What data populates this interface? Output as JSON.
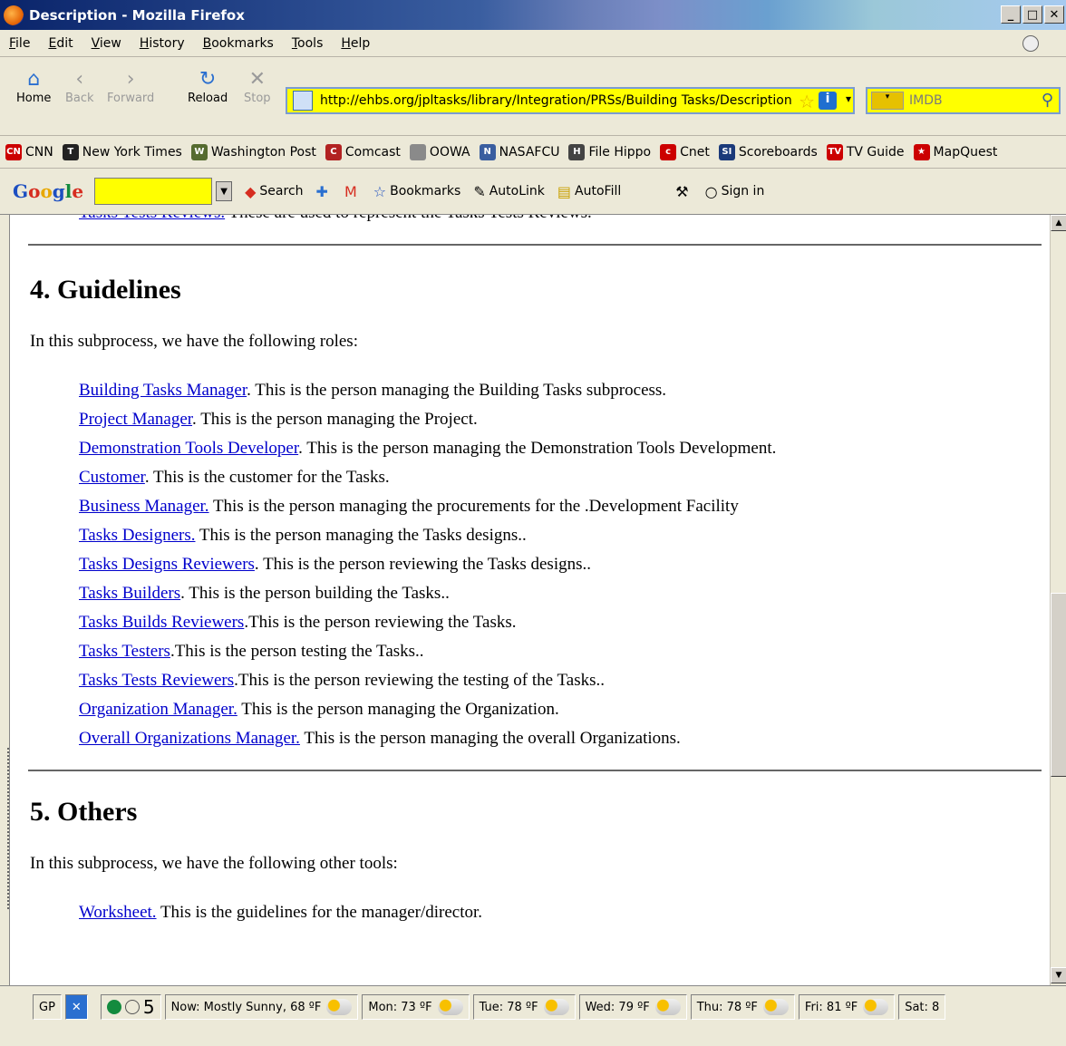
{
  "window": {
    "title": "Description - Mozilla Firefox"
  },
  "menu": [
    "File",
    "Edit",
    "View",
    "History",
    "Bookmarks",
    "Tools",
    "Help"
  ],
  "nav": {
    "home": "Home",
    "back": "Back",
    "forward": "Forward",
    "reload": "Reload",
    "stop": "Stop",
    "url": "http://ehbs.org/jpltasks/library/Integration/PRSs/Building Tasks/Description.h",
    "search_placeholder": "IMDB"
  },
  "bookmarks": [
    {
      "label": "CNN",
      "icon": "cnn-icon",
      "color": "#cc0000",
      "glyph": "CN"
    },
    {
      "label": "New York Times",
      "icon": "nyt-icon",
      "color": "#222222",
      "glyph": "T"
    },
    {
      "label": "Washington Post",
      "icon": "wapo-icon",
      "color": "#556b2f",
      "glyph": "W"
    },
    {
      "label": "Comcast",
      "icon": "comcast-icon",
      "color": "#b22222",
      "glyph": "C"
    },
    {
      "label": "OOWA",
      "icon": "page-icon",
      "color": "#8a8a8a",
      "glyph": ""
    },
    {
      "label": "NASAFCU",
      "icon": "nasafcu-icon",
      "color": "#3a5ea0",
      "glyph": "N"
    },
    {
      "label": "File Hippo",
      "icon": "filehippo-icon",
      "color": "#444444",
      "glyph": "H"
    },
    {
      "label": "Cnet",
      "icon": "cnet-icon",
      "color": "#cc0000",
      "glyph": "c"
    },
    {
      "label": "Scoreboards",
      "icon": "si-icon",
      "color": "#1b3a7a",
      "glyph": "SI"
    },
    {
      "label": "TV Guide",
      "icon": "tvguide-icon",
      "color": "#cc0000",
      "glyph": "TV"
    },
    {
      "label": "MapQuest",
      "icon": "mapquest-icon",
      "color": "#cc0000",
      "glyph": "★"
    }
  ],
  "google_toolbar": {
    "search": "Search",
    "bookmarks": "Bookmarks",
    "autolink": "AutoLink",
    "autofill": "AutoFill",
    "signin": "Sign in"
  },
  "content": {
    "top_link": "Tasks Tests Reviews.",
    "top_text": " These are used to represent the Tasks Tests Reviews.",
    "section4": {
      "heading": "4. Guidelines",
      "intro": "In this subprocess, we have the following roles:",
      "roles": [
        {
          "link": "Building Tasks Manager",
          "text": ". This is the person managing the Building Tasks subprocess."
        },
        {
          "link": "Project Manager",
          "text": ". This is the person managing the Project."
        },
        {
          "link": "Demonstration Tools Developer",
          "text": ". This is the person managing the Demonstration Tools Development."
        },
        {
          "link": "Customer",
          "text": ". This is the customer for the Tasks."
        },
        {
          "link": "Business Manager.",
          "text": " This is the person managing the procurements for the .Development Facility"
        },
        {
          "link": "Tasks Designers.",
          "text": " This is the person managing the Tasks designs.."
        },
        {
          "link": "Tasks Designs Reviewers",
          "text": ". This is the person reviewing the Tasks designs.."
        },
        {
          "link": "Tasks Builders",
          "text": ". This is the person building the Tasks.."
        },
        {
          "link": "Tasks Builds Reviewers",
          "text": ".This is the person reviewing the Tasks."
        },
        {
          "link": "Tasks Testers",
          "text": ".This is the person testing the Tasks.."
        },
        {
          "link": "Tasks Tests Reviewers",
          "text": ".This is the person reviewing the testing of the Tasks.."
        },
        {
          "link": "Organization Manager.",
          "text": " This is the person managing the Organization."
        },
        {
          "link": "Overall Organizations Manager.",
          "text": " This is the person managing the overall Organizations."
        }
      ]
    },
    "section5": {
      "heading": "5. Others",
      "intro": "In this subprocess, we have the following other tools:",
      "tools": [
        {
          "link": "Worksheet.",
          "text": " This is the guidelines for the manager/director."
        }
      ]
    }
  },
  "status": {
    "counter": "5",
    "weather": [
      "Now: Mostly Sunny, 68 ºF",
      "Mon: 73 ºF",
      "Tue: 78 ºF",
      "Wed: 79 ºF",
      "Thu: 78 ºF",
      "Fri: 81 ºF",
      "Sat: 8"
    ]
  }
}
